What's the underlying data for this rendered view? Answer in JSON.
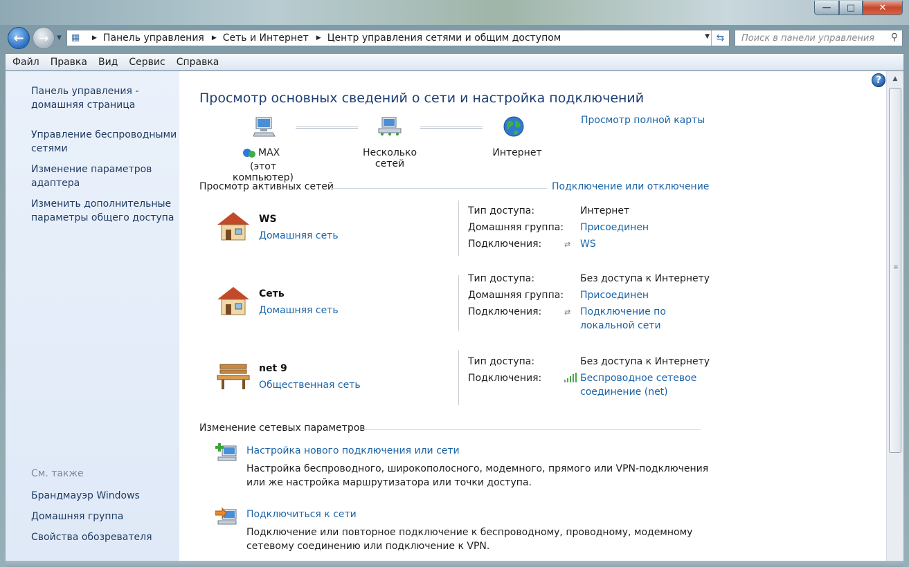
{
  "window": {
    "caption_min": "—",
    "caption_max": "□",
    "caption_close": "✕"
  },
  "nav": {
    "back_glyph": "←",
    "forward_glyph": "→",
    "breadcrumbs": [
      "Панель управления",
      "Сеть и Интернет",
      "Центр управления сетями и общим доступом"
    ],
    "search_placeholder": "Поиск в панели управления"
  },
  "menu": [
    "Файл",
    "Правка",
    "Вид",
    "Сервис",
    "Справка"
  ],
  "sidebar": {
    "links": [
      "Панель управления - домашняя страница",
      "Управление беспроводными сетями",
      "Изменение параметров адаптера",
      "Изменить дополнительные параметры общего доступа"
    ],
    "see_also": "См. также",
    "see_also_links": [
      "Брандмауэр Windows",
      "Домашняя группа",
      "Свойства обозревателя"
    ]
  },
  "main": {
    "title": "Просмотр основных сведений о сети и настройка подключений",
    "view_full_map": "Просмотр полной карты",
    "map": {
      "computer_name": "MAX",
      "computer_sub": "(этот компьютер)",
      "middle": "Несколько сетей",
      "internet": "Интернет"
    },
    "active_title": "Просмотр активных сетей",
    "connect_disconnect": "Подключение или отключение",
    "labels": {
      "access_type": "Тип доступа:",
      "homegroup": "Домашняя группа:",
      "connections": "Подключения:"
    },
    "networks": [
      {
        "name": "WS",
        "type": "Домашняя сеть",
        "access": "Интернет",
        "homegroup": "Присоединен",
        "connection": "WS"
      },
      {
        "name": "Сеть",
        "type": "Домашняя сеть",
        "access": "Без доступа к Интернету",
        "homegroup": "Присоединен",
        "connection_line1": "Подключение по",
        "connection_line2": "локальной сети"
      },
      {
        "name": "net  9",
        "type": "Общественная сеть",
        "access": "Без доступа к Интернету",
        "connection_line1": "Беспроводное сетевое",
        "connection_line2": "соединение (net)"
      }
    ],
    "change_title": "Изменение сетевых параметров",
    "tasks": [
      {
        "link": "Настройка нового подключения или сети",
        "desc_line1": "Настройка беспроводного, широкополосного, модемного, прямого или VPN-подключения",
        "desc_line2": "или же настройка маршрутизатора или точки доступа."
      },
      {
        "link": "Подключиться к сети",
        "desc_line1": "Подключение или повторное подключение к беспроводному, проводному, модемному",
        "desc_line2": "сетевому соединению или подключение к VPN."
      }
    ]
  },
  "colors": {
    "link": "#1a64a8",
    "title": "#1c3e72",
    "sidebar_bg": "#e3ecf8"
  }
}
